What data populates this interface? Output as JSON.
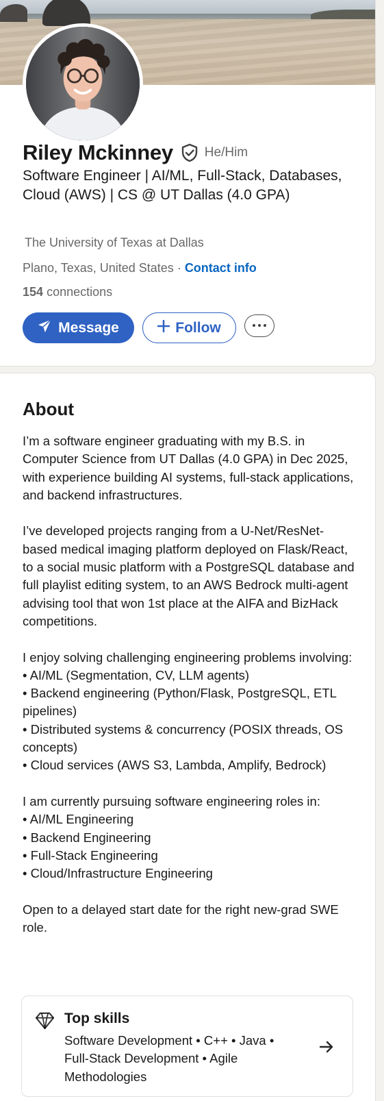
{
  "profile": {
    "name": "Riley Mckinney",
    "pronouns": "He/Him",
    "verified_icon": "shield-check-icon",
    "headline": "Software Engineer | AI/ML, Full-Stack, Databases, Cloud (AWS) | CS @ UT Dallas (4.0 GPA)",
    "school": "The University of Texas at Dallas",
    "location": "Plano, Texas, United States",
    "separator": " · ",
    "contact_label": "Contact info",
    "connections_count": "154",
    "connections_label": "connections",
    "actions": {
      "message_label": "Message",
      "follow_label": "Follow",
      "more_icon": "ellipsis-icon"
    }
  },
  "about": {
    "title": "About",
    "paragraphs": [
      [
        "I’m a software engineer graduating with my B.S. in Computer Science from UT Dallas (4.0 GPA) in Dec 2025, with experience building AI systems, full-stack applications, and backend infrastructures."
      ],
      [
        "I’ve developed projects ranging from a U-Net/ResNet-based medical imaging platform deployed on Flask/React, to a social music platform with a PostgreSQL database and full playlist editing system, to an AWS Bedrock multi-agent advising tool that won 1st place at the AIFA and BizHack competitions."
      ],
      [
        "I enjoy solving challenging engineering problems involving:",
        "• AI/ML (Segmentation, CV, LLM agents)",
        "• Backend engineering (Python/Flask, PostgreSQL, ETL pipelines)",
        "• Distributed systems & concurrency (POSIX threads, OS concepts)",
        "• Cloud services (AWS S3, Lambda, Amplify, Bedrock)"
      ],
      [
        "I am currently pursuing software engineering roles in:",
        "• AI/ML Engineering",
        "• Backend Engineering",
        "• Full-Stack Engineering",
        "• Cloud/Infrastructure Engineering"
      ],
      [
        "Open to a delayed start date for the right new-grad SWE role."
      ]
    ],
    "top_skills": {
      "icon": "diamond-icon",
      "title": "Top skills",
      "list": "Software Development • C++ • Java • Full-Stack Development • Agile Methodologies",
      "arrow_icon": "arrow-right-icon"
    }
  },
  "colors": {
    "accent": "#0a66c2",
    "button_primary": "#2f62c3",
    "page_background": "#f4f2ee"
  }
}
